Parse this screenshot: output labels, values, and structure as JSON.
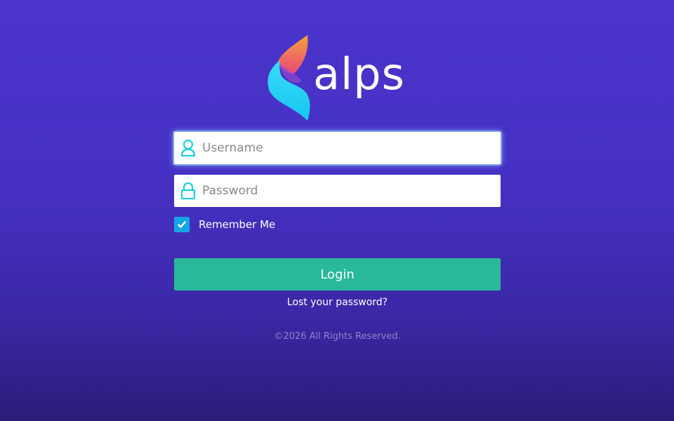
{
  "brand": {
    "name": "alps",
    "logo_icon": "flame-s-icon",
    "colors": {
      "gradient_top": "#f7a23a",
      "gradient_mid": "#e8467c",
      "gradient_bottom": "#20d3f5"
    }
  },
  "form": {
    "username": {
      "placeholder": "Username",
      "value": "",
      "icon": "user-icon"
    },
    "password": {
      "placeholder": "Password",
      "value": "",
      "icon": "lock-icon"
    },
    "remember_me": {
      "label": "Remember Me",
      "checked": true
    },
    "login_label": "Login",
    "lost_password_label": "Lost your password?"
  },
  "footer": {
    "copyright": "©2026 All Rights Reserved."
  },
  "colors": {
    "accent": "#29b99a",
    "checkbox": "#13a6e6",
    "icon": "#1ecfe0"
  }
}
